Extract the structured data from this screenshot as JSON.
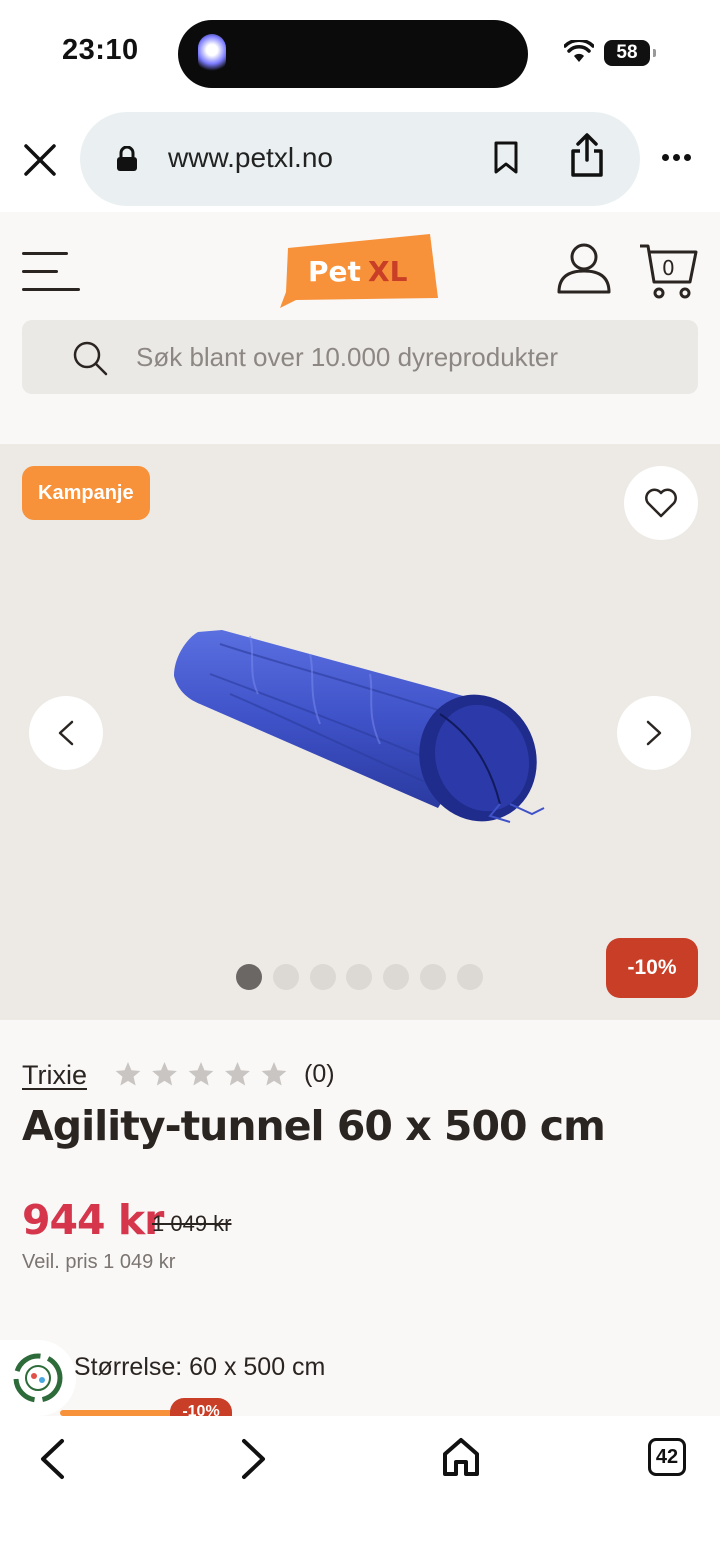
{
  "status_bar": {
    "time": "23:10",
    "battery": "58"
  },
  "browser": {
    "url": "www.petxl.no",
    "tab_count": "42"
  },
  "header": {
    "logo_text_1": "Pet",
    "logo_text_2": "XL",
    "cart_count": "0",
    "search_placeholder": "Søk blant over 10.000 dyreprodukter"
  },
  "gallery": {
    "campaign_badge": "Kampanje",
    "discount_badge": "-10%",
    "image_count": 7,
    "active_image_index": 0
  },
  "product": {
    "brand": "Trixie",
    "rating": 0,
    "max_rating": 5,
    "review_count": "(0)",
    "title": "Agility-tunnel 60 x 500 cm",
    "price": "944 kr",
    "old_price": "1 049 kr",
    "recommended_price": "Veil. pris 1 049 kr",
    "size_label": "t Størrelse: 60 x 500 cm",
    "variant_discount": "-10%"
  },
  "colors": {
    "brand_orange": "#f7913a",
    "price_red": "#d6364c",
    "discount_red": "#c93e26",
    "tunnel_blue": "#3f52c8"
  }
}
